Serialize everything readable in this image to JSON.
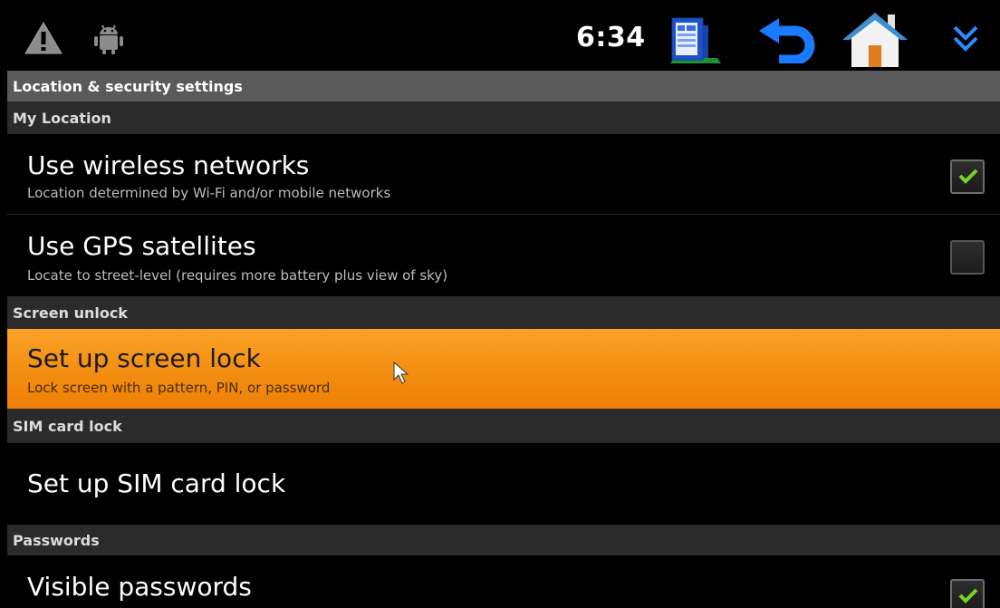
{
  "statusbar": {
    "time": "6:34",
    "icons": [
      "warning-icon",
      "android-debug-icon",
      "notes-icon",
      "back-arrow-icon",
      "home-icon",
      "chevron-down-icon"
    ]
  },
  "screen_title": "Location & security settings",
  "sections": [
    {
      "header": "My Location"
    },
    {
      "header": "Screen unlock"
    },
    {
      "header": "SIM card lock"
    },
    {
      "header": "Passwords"
    }
  ],
  "items": {
    "wireless": {
      "title": "Use wireless networks",
      "summary": "Location determined by Wi-Fi and/or mobile networks",
      "checked": true
    },
    "gps": {
      "title": "Use GPS satellites",
      "summary": "Locate to street-level (requires more battery plus view of sky)",
      "checked": false
    },
    "screen_lock": {
      "title": "Set up screen lock",
      "summary": "Lock screen with a pattern, PIN, or password",
      "selected": true
    },
    "sim_lock": {
      "title": "Set up SIM card lock"
    },
    "visible_passwords": {
      "title": "Visible passwords",
      "checked": true
    }
  },
  "colors": {
    "highlight": "#f39214",
    "section_header": "#2b2b2b",
    "title_header": "#5a5a5a",
    "check_green": "#7bd321"
  }
}
